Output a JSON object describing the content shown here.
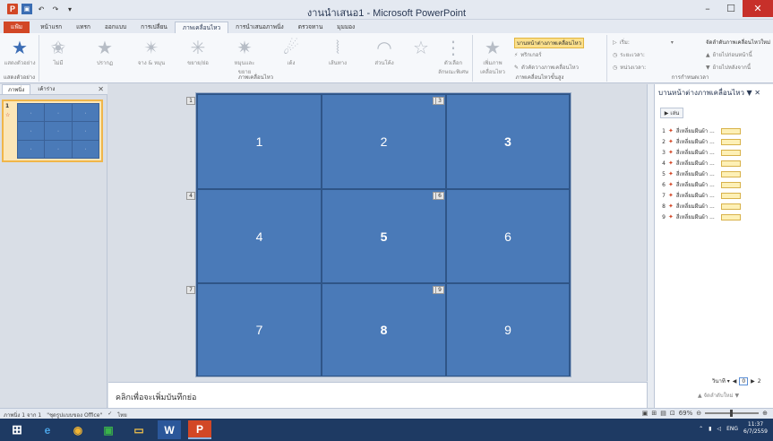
{
  "window": {
    "title": "งานนำเสนอ1 - Microsoft PowerPoint",
    "minimize": "–",
    "maximize": "☐",
    "close": "✕"
  },
  "qat": {
    "logo": "P",
    "save": "▣",
    "undo": "↶",
    "redo": "↷",
    "customize": "▾"
  },
  "tabs": [
    "แฟ้ม",
    "หน้าแรก",
    "แทรก",
    "ออกแบบ",
    "การเปลี่ยน",
    "ภาพเคลื่อนไหว",
    "การนำเสนอภาพนิ่ง",
    "ตรวจทาน",
    "มุมมอง"
  ],
  "ribbon": {
    "preview_label": "แสดงตัวอย่าง",
    "preview_group": "แสดงตัวอย่าง",
    "effects": [
      "ไม่มี",
      "ปรากฏ",
      "จาง & หมุน",
      "ขยาย/ย่อ",
      "หมุนและขยาย",
      "เด้ง",
      "เส้นทาง",
      "ส่วนโค้ง"
    ],
    "effect_options": "ตัวเลือกลักษณะพิเศษ",
    "anim_group": "ภาพเคลื่อนไหว",
    "add_animation": "เพิ่มภาพเคลื่อนไหว",
    "anim_pane": "บานหน้าต่างภาพเคลื่อนไหว",
    "trigger": "ทริกเกอร์",
    "painter": "ตัวคัดวางภาพเคลื่อนไหว",
    "adv_group": "ภาพเคลื่อนไหวขั้นสูง",
    "start": "เริ่ม:",
    "duration": "ระยะเวลา:",
    "delay": "หน่วงเวลา:",
    "reorder": "จัดลำดับภาพเคลื่อนไหวใหม่",
    "move_earlier": "ย้ายไปก่อนหน้านี้",
    "move_later": "ย้ายไปหลังจากนี้",
    "timing_group": "การกำหนดเวลา"
  },
  "left_panel": {
    "tab_slides": "ภาพนิ่ง",
    "tab_outline": "เค้าร่าง",
    "close": "✕",
    "slide_number": "1",
    "anim_mark": "☆"
  },
  "slide": {
    "cells": [
      "1",
      "2",
      "3",
      "4",
      "5",
      "6",
      "7",
      "8",
      "9"
    ],
    "tags": [
      "1",
      "2",
      "3",
      "4",
      "5",
      "6",
      "7",
      "8",
      "9"
    ],
    "notes_placeholder": "คลิกเพื่อจะเพิ่มบันทึกย่อ"
  },
  "right_panel": {
    "title": "บานหน้าต่างภาพเคลื่อนไหว ▼ ✕",
    "play": "เล่น",
    "items": [
      {
        "num": "1",
        "label": "สี่เหลี่ยมผืนผ้า ..."
      },
      {
        "num": "2",
        "label": "สี่เหลี่ยมผืนผ้า ..."
      },
      {
        "num": "3",
        "label": "สี่เหลี่ยมผืนผ้า ..."
      },
      {
        "num": "4",
        "label": "สี่เหลี่ยมผืนผ้า ..."
      },
      {
        "num": "5",
        "label": "สี่เหลี่ยมผืนผ้า ..."
      },
      {
        "num": "6",
        "label": "สี่เหลี่ยมผืนผ้า ..."
      },
      {
        "num": "7",
        "label": "สี่เหลี่ยมผืนผ้า ..."
      },
      {
        "num": "8",
        "label": "สี่เหลี่ยมผืนผ้า ..."
      },
      {
        "num": "9",
        "label": "สี่เหลี่ยมผืนผ้า ..."
      }
    ],
    "seconds": "วินาที ▾",
    "timeline_start": "0",
    "timeline_end": "2",
    "reorder": "จัดลำดับใหม่"
  },
  "status": {
    "slide": "ภาพนิ่ง 1 จาก 1",
    "theme": "\"ชุดรูปแบบของ Office\"",
    "language": "ไทย",
    "zoom": "69%"
  },
  "taskbar": {
    "time": "11:37",
    "date": "6/7/2559",
    "lang": "ENG"
  },
  "colors": {
    "accent": "#d24726",
    "slide_fill": "#4a7ab8"
  }
}
